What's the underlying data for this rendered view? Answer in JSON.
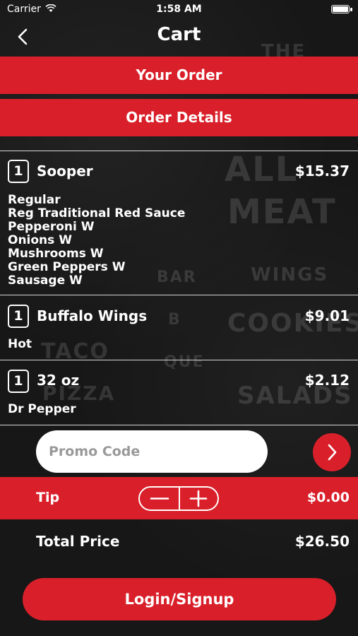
{
  "status_bar": {
    "carrier": "Carrier",
    "time": "1:58 AM"
  },
  "nav": {
    "title": "Cart",
    "back_icon": "chevron-left-icon"
  },
  "sections": {
    "your_order": "Your Order",
    "order_details": "Order Details"
  },
  "items": [
    {
      "qty": "1",
      "name": "Sooper",
      "price": "$15.37",
      "modifiers": [
        "Regular",
        "Reg Traditional Red Sauce",
        "Pepperoni W",
        "Onions W",
        "Mushrooms W",
        "Green Peppers W",
        "Sausage W"
      ]
    },
    {
      "qty": "1",
      "name": "Buffalo Wings",
      "price": "$9.01",
      "modifiers": [
        "Hot"
      ]
    },
    {
      "qty": "1",
      "name": "32 oz",
      "price": "$2.12",
      "modifiers": [
        "Dr Pepper"
      ]
    }
  ],
  "promo": {
    "placeholder": "Promo Code",
    "go_icon": "chevron-right-icon"
  },
  "tip": {
    "label": "Tip",
    "value": "$0.00",
    "minus": "−",
    "plus": "+"
  },
  "total": {
    "label": "Total Price",
    "value": "$26.50"
  },
  "login_button": "Login/Signup",
  "background_text": [
    "ALL",
    "MEAT",
    "WINGS",
    "COOKIES",
    "SALADS",
    "BAR",
    "B",
    "QUE",
    "TACO",
    "PIZZA",
    "THE"
  ],
  "colors": {
    "accent": "#d9202a",
    "background": "#171717",
    "text": "#ffffff"
  }
}
